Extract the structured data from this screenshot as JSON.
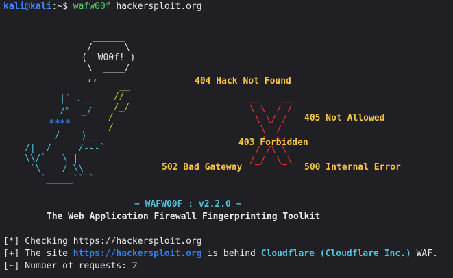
{
  "terminal": {
    "prompt": {
      "user_host": "kali@kali",
      "path": ":~$",
      "command": "wafw00f",
      "argument": "hackersploit.org"
    },
    "banner": {
      "dog_gray_top": "       ______\n      /      \\\n     (  W00f! )\n      \\  ____/\n      ,,",
      "dog_cyan_1": "    |`-.__",
      "dog_cyan_2": "    /\"  _/",
      "dog_blue": "  ****",
      "dog_cyan_3": "   /    )__",
      "dog_cyan_rest": "/|  /     /---`\n\\\\/`   \\ |\n `\\    /_\\\\_\n   `_____``-`",
      "dog_green": "  __\n //\n /_/\n/\n/",
      "x_art": "__    __\n\\ \\  / /\n \\ \\/ /\n  \\  /\n  /  \\\n / /\\ \\\n/_/  \\_\\",
      "labels": {
        "e404": "404 Hack Not Found",
        "e405": "405 Not Allowed",
        "e403": "403 Forbidden",
        "e502": "502 Bad Gateway",
        "e500": "500 Internal Error"
      },
      "version_prefix": "~ WAFW00F : ",
      "version": "v2.2.0",
      "version_suffix": " ~",
      "tagline": "The Web Application Firewall Fingerprinting Toolkit"
    },
    "output": {
      "checking": "[*] Checking https://hackersploit.org",
      "site_prefix": "[+] The site ",
      "site_url": "https://hackersploit.org",
      "site_middle": " is behind ",
      "waf_name": "Cloudflare (Cloudflare Inc.)",
      "site_suffix": " WAF.",
      "requests": "[~] Number of requests: 2"
    },
    "colors": {
      "background": "#1f1f24",
      "text": "#e6e6e6",
      "prompt": "#3f87ff",
      "command": "#56d26e",
      "dog_cyan": "#4fc4d8",
      "dog_blue": "#2f7fe8",
      "dog_green": "#a6d432",
      "x_red": "#e03030",
      "label_yellow": "#f5c542",
      "link_blue": "#2f7fe8",
      "waf_cyan": "#4fc4d8"
    }
  }
}
